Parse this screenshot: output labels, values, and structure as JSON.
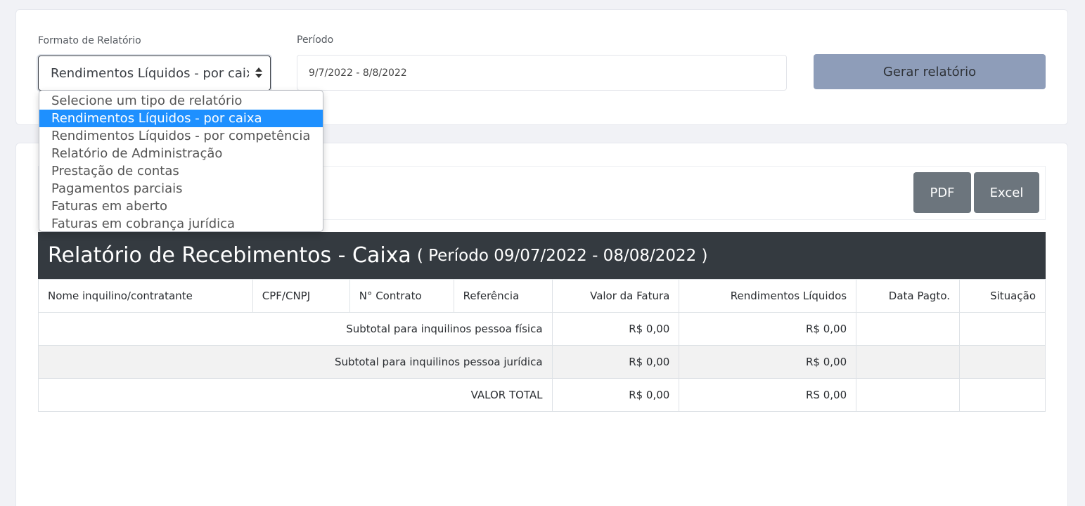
{
  "filters": {
    "format_label": "Formato de Relatório",
    "format_value": "Rendimentos Líquidos - por caixa",
    "period_label": "Período",
    "period_value": "9/7/2022 - 8/8/2022",
    "generate_button": "Gerar relatório"
  },
  "dropdown": {
    "options": [
      "Selecione um tipo de relatório",
      "Rendimentos Líquidos - por caixa",
      "Rendimentos Líquidos - por competência",
      "Relatório de Administração",
      "Prestação de contas",
      "Pagamentos parciais",
      "Faturas em aberto",
      "Faturas em cobrança jurídica"
    ],
    "selected_index": 1
  },
  "export": {
    "pdf_label": "PDF",
    "excel_label": "Excel"
  },
  "report": {
    "title": "Relatório de Recebimentos - Caixa",
    "period": "( Período 09/07/2022 - 08/08/2022 )",
    "columns": [
      "Nome inquilino/contratante",
      "CPF/CNPJ",
      "N° Contrato",
      "Referência",
      "Valor da Fatura",
      "Rendimentos Líquidos",
      "Data Pagto.",
      "Situação"
    ],
    "rows": [
      {
        "label": "Subtotal para inquilinos pessoa física",
        "valor": "R$ 0,00",
        "rendimentos": "R$ 0,00"
      },
      {
        "label": "Subtotal para inquilinos pessoa jurídica",
        "valor": "R$ 0,00",
        "rendimentos": "R$ 0,00"
      },
      {
        "label": "VALOR TOTAL",
        "valor": "R$ 0,00",
        "rendimentos": "RS 0,00"
      }
    ]
  },
  "colors": {
    "selected_option": "#1e90ff",
    "generate_button_bg": "#8e9db9",
    "export_button_bg": "#6c757d",
    "report_header_bg": "#343a40"
  }
}
